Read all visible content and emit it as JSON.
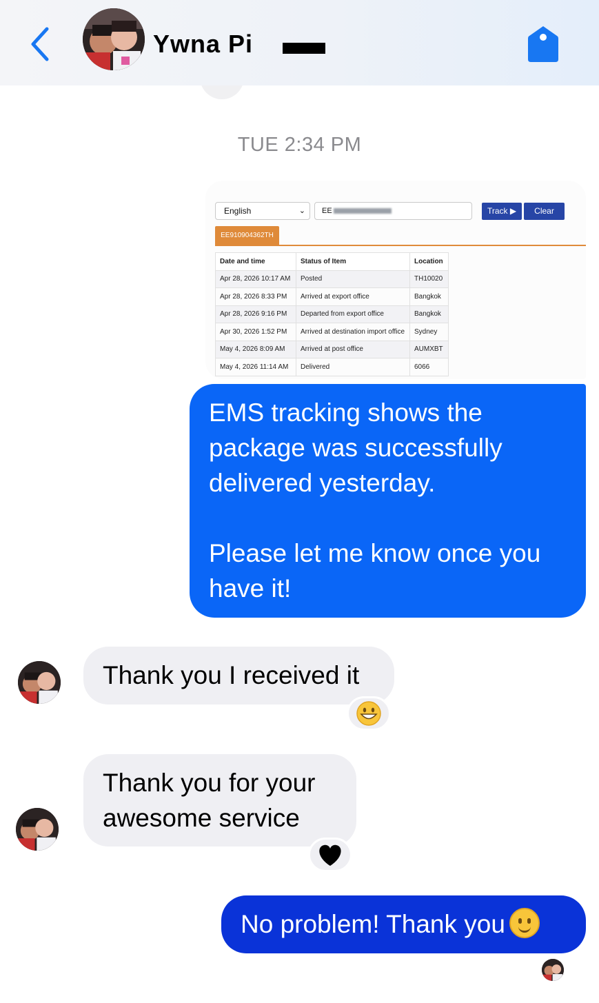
{
  "header": {
    "contact_name": "Ywna Pi",
    "back_icon": "chevron-left-icon",
    "tag_icon": "tag-icon",
    "accent_color": "#0a66f7"
  },
  "thread": {
    "timestamp": "TUE 2:34 PM"
  },
  "attachment": {
    "language": "English",
    "tracking_input_prefix": "EE",
    "track_button": "Track ▶",
    "clear_button": "Clear",
    "tracking_number_tab": "EE910904362TH",
    "columns": [
      "Date and time",
      "Status of Item",
      "Location"
    ],
    "rows": [
      {
        "date": "Apr 28, 2026 10:17 AM",
        "status": "Posted",
        "location": "TH10020"
      },
      {
        "date": "Apr 28, 2026 8:33 PM",
        "status": "Arrived at export office",
        "location": "Bangkok"
      },
      {
        "date": "Apr 28, 2026 9:16 PM",
        "status": "Departed from export office",
        "location": "Bangkok"
      },
      {
        "date": "Apr 30, 2026 1:52 PM",
        "status": "Arrived at destination import office",
        "location": "Sydney"
      },
      {
        "date": "May 4, 2026 8:09 AM",
        "status": "Arrived at post office",
        "location": "AUMXBT"
      },
      {
        "date": "May 4, 2026 11:14 AM",
        "status": "Delivered",
        "location": "6066"
      }
    ]
  },
  "messages": {
    "msg1_line1": "EMS tracking shows the",
    "msg1_line2": "package was successfully",
    "msg1_line3": "delivered yesterday.",
    "msg1_line4": "Please let me know once you",
    "msg1_line5": "have it!",
    "msg2": "Thank you I received it",
    "msg2_reaction": "grinning-face-emoji",
    "msg3_line1": "Thank you for your",
    "msg3_line2": "awesome service",
    "msg3_reaction": "black-heart-emoji",
    "msg4": "No problem! Thank you"
  }
}
